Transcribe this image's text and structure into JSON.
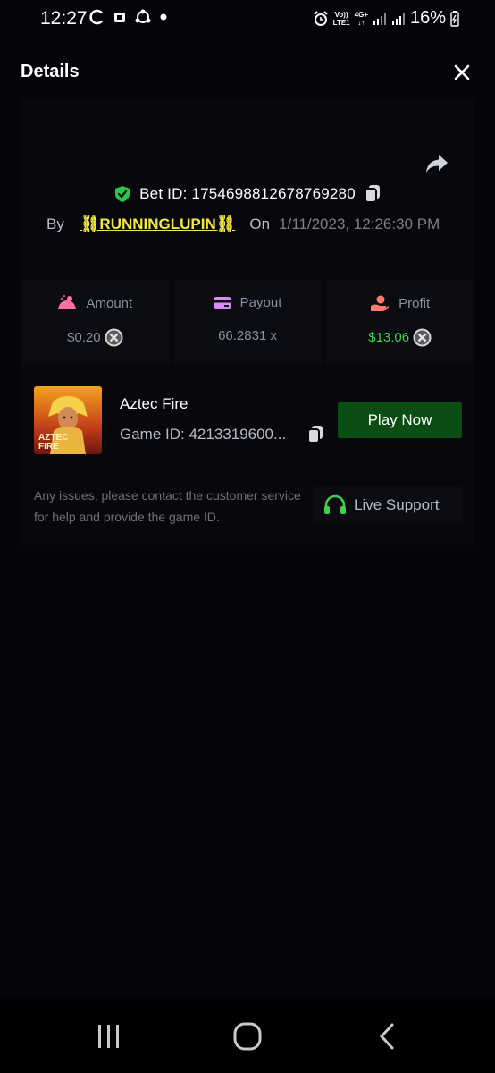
{
  "status_bar": {
    "time": "12:27",
    "battery": "16%",
    "network_label_top": "Vo))",
    "network_label_bottom": "LTE1",
    "network_gen": "4G+"
  },
  "header": {
    "title": "Details"
  },
  "bet": {
    "id_text": "Bet ID: 1754698812678769280",
    "by_label": "By",
    "user": "⛓RUNNINGLUPIN⛓",
    "on_label": "On",
    "date": "1/11/2023, 12:26:30 PM"
  },
  "stats": {
    "amount": {
      "label": "Amount",
      "value": "$0.20"
    },
    "payout": {
      "label": "Payout",
      "value": "66.2831 x"
    },
    "profit": {
      "label": "Profit",
      "value": "$13.06"
    }
  },
  "game": {
    "title": "Aztec Fire",
    "id_text": "Game ID: 4213319600...",
    "thumb_text_1": "AZTEC",
    "thumb_text_2": "FIRE",
    "play_label": "Play Now"
  },
  "support": {
    "help_text": "Any issues, please contact the customer service for help and provide the game ID.",
    "button_label": "Live Support"
  },
  "colors": {
    "accent_green": "#3fd14e",
    "play_button": "#0b4d12",
    "username": "#f2e84a",
    "background": "#050509"
  },
  "icons": {
    "close": "close-icon",
    "share": "share-icon",
    "shield": "shield-check-icon",
    "copy": "copy-icon",
    "amount": "amount-icon",
    "payout": "card-icon",
    "profit": "hand-coin-icon",
    "coin": "coin-icon",
    "headset": "headset-icon"
  }
}
